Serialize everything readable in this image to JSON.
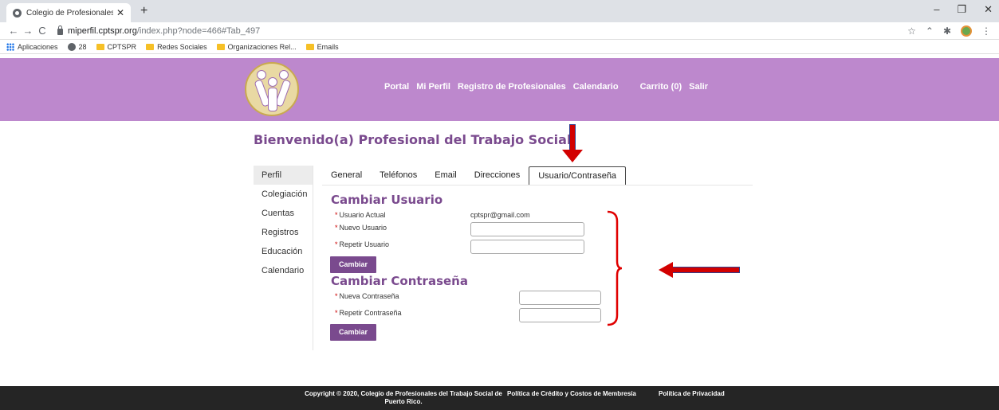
{
  "browser": {
    "tab_title": "Colegio de Profesionales del Trab",
    "url_host": "miperfil.cptspr.org",
    "url_path": "/index.php?node=466#Tab_497",
    "bookmarks": [
      "Aplicaciones",
      "28",
      "CPTSPR",
      "Redes Sociales",
      "Organizaciones Rel...",
      "Emails"
    ]
  },
  "header": {
    "nav": [
      "Portal",
      "Mi Perfil",
      "Registro de Profesionales",
      "Calendario"
    ],
    "cart": "Carrito (0)",
    "logout": "Salir",
    "bg_color": "#bd88cd"
  },
  "page": {
    "welcome": "Bienvenido(a) Profesional del Trabajo Social"
  },
  "sidebar": {
    "items": [
      "Perfil",
      "Colegiación",
      "Cuentas",
      "Registros",
      "Educación",
      "Calendario"
    ]
  },
  "tabs": {
    "items": [
      "General",
      "Teléfonos",
      "Email",
      "Direcciones",
      "Usuario/Contraseña"
    ],
    "active": "Usuario/Contraseña"
  },
  "user_form": {
    "title": "Cambiar Usuario",
    "current_label": "Usuario Actual",
    "current_value": "cptspr@gmail.com",
    "new_label": "Nuevo Usuario",
    "repeat_label": "Repetir Usuario",
    "button": "Cambiar"
  },
  "password_form": {
    "title": "Cambiar Contraseña",
    "new_label": "Nueva Contraseña",
    "repeat_label": "Repetir Contraseña",
    "button": "Cambiar"
  },
  "footer": {
    "copyright": "Copyright © 2020, Colegio de Profesionales del Trabajo Social de Puerto Rico.",
    "link1": "Política de Crédito y Costos de Membresía",
    "link2": "Política de Privacidad"
  }
}
